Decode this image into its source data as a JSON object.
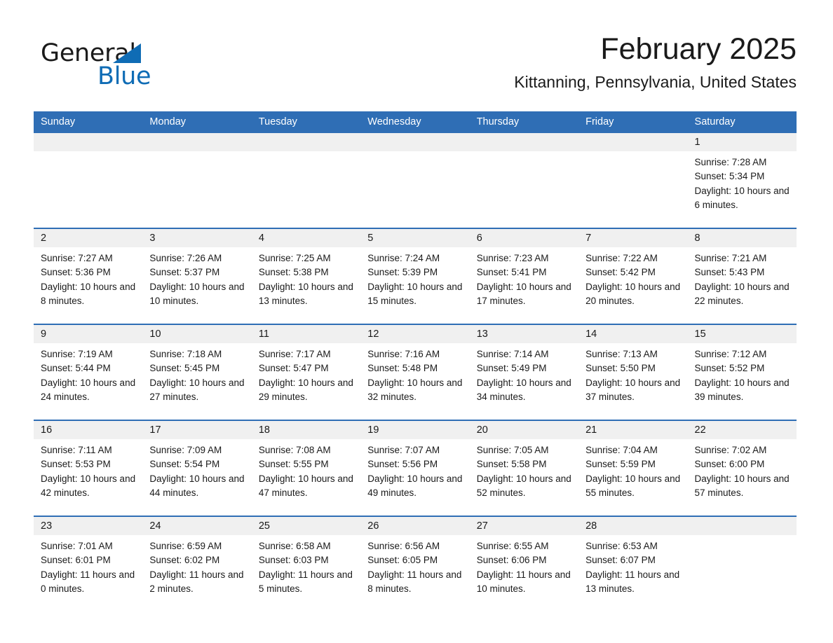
{
  "brand": {
    "word_one": "General",
    "word_two": "Blue",
    "triangle_color": "#0f6cb5",
    "accent_color": "#2f6eb5"
  },
  "header": {
    "title": "February 2025",
    "subtitle": "Kittanning, Pennsylvania, United States"
  },
  "calendar": {
    "weekday_headers": [
      "Sunday",
      "Monday",
      "Tuesday",
      "Wednesday",
      "Thursday",
      "Friday",
      "Saturday"
    ],
    "labels": {
      "sunrise": "Sunrise:",
      "sunset": "Sunset:",
      "daylight": "Daylight:"
    },
    "weeks": [
      [
        {
          "day": "",
          "sunrise": "",
          "sunset": "",
          "daylight": ""
        },
        {
          "day": "",
          "sunrise": "",
          "sunset": "",
          "daylight": ""
        },
        {
          "day": "",
          "sunrise": "",
          "sunset": "",
          "daylight": ""
        },
        {
          "day": "",
          "sunrise": "",
          "sunset": "",
          "daylight": ""
        },
        {
          "day": "",
          "sunrise": "",
          "sunset": "",
          "daylight": ""
        },
        {
          "day": "",
          "sunrise": "",
          "sunset": "",
          "daylight": ""
        },
        {
          "day": "1",
          "sunrise": "Sunrise: 7:28 AM",
          "sunset": "Sunset: 5:34 PM",
          "daylight": "Daylight: 10 hours and 6 minutes."
        }
      ],
      [
        {
          "day": "2",
          "sunrise": "Sunrise: 7:27 AM",
          "sunset": "Sunset: 5:36 PM",
          "daylight": "Daylight: 10 hours and 8 minutes."
        },
        {
          "day": "3",
          "sunrise": "Sunrise: 7:26 AM",
          "sunset": "Sunset: 5:37 PM",
          "daylight": "Daylight: 10 hours and 10 minutes."
        },
        {
          "day": "4",
          "sunrise": "Sunrise: 7:25 AM",
          "sunset": "Sunset: 5:38 PM",
          "daylight": "Daylight: 10 hours and 13 minutes."
        },
        {
          "day": "5",
          "sunrise": "Sunrise: 7:24 AM",
          "sunset": "Sunset: 5:39 PM",
          "daylight": "Daylight: 10 hours and 15 minutes."
        },
        {
          "day": "6",
          "sunrise": "Sunrise: 7:23 AM",
          "sunset": "Sunset: 5:41 PM",
          "daylight": "Daylight: 10 hours and 17 minutes."
        },
        {
          "day": "7",
          "sunrise": "Sunrise: 7:22 AM",
          "sunset": "Sunset: 5:42 PM",
          "daylight": "Daylight: 10 hours and 20 minutes."
        },
        {
          "day": "8",
          "sunrise": "Sunrise: 7:21 AM",
          "sunset": "Sunset: 5:43 PM",
          "daylight": "Daylight: 10 hours and 22 minutes."
        }
      ],
      [
        {
          "day": "9",
          "sunrise": "Sunrise: 7:19 AM",
          "sunset": "Sunset: 5:44 PM",
          "daylight": "Daylight: 10 hours and 24 minutes."
        },
        {
          "day": "10",
          "sunrise": "Sunrise: 7:18 AM",
          "sunset": "Sunset: 5:45 PM",
          "daylight": "Daylight: 10 hours and 27 minutes."
        },
        {
          "day": "11",
          "sunrise": "Sunrise: 7:17 AM",
          "sunset": "Sunset: 5:47 PM",
          "daylight": "Daylight: 10 hours and 29 minutes."
        },
        {
          "day": "12",
          "sunrise": "Sunrise: 7:16 AM",
          "sunset": "Sunset: 5:48 PM",
          "daylight": "Daylight: 10 hours and 32 minutes."
        },
        {
          "day": "13",
          "sunrise": "Sunrise: 7:14 AM",
          "sunset": "Sunset: 5:49 PM",
          "daylight": "Daylight: 10 hours and 34 minutes."
        },
        {
          "day": "14",
          "sunrise": "Sunrise: 7:13 AM",
          "sunset": "Sunset: 5:50 PM",
          "daylight": "Daylight: 10 hours and 37 minutes."
        },
        {
          "day": "15",
          "sunrise": "Sunrise: 7:12 AM",
          "sunset": "Sunset: 5:52 PM",
          "daylight": "Daylight: 10 hours and 39 minutes."
        }
      ],
      [
        {
          "day": "16",
          "sunrise": "Sunrise: 7:11 AM",
          "sunset": "Sunset: 5:53 PM",
          "daylight": "Daylight: 10 hours and 42 minutes."
        },
        {
          "day": "17",
          "sunrise": "Sunrise: 7:09 AM",
          "sunset": "Sunset: 5:54 PM",
          "daylight": "Daylight: 10 hours and 44 minutes."
        },
        {
          "day": "18",
          "sunrise": "Sunrise: 7:08 AM",
          "sunset": "Sunset: 5:55 PM",
          "daylight": "Daylight: 10 hours and 47 minutes."
        },
        {
          "day": "19",
          "sunrise": "Sunrise: 7:07 AM",
          "sunset": "Sunset: 5:56 PM",
          "daylight": "Daylight: 10 hours and 49 minutes."
        },
        {
          "day": "20",
          "sunrise": "Sunrise: 7:05 AM",
          "sunset": "Sunset: 5:58 PM",
          "daylight": "Daylight: 10 hours and 52 minutes."
        },
        {
          "day": "21",
          "sunrise": "Sunrise: 7:04 AM",
          "sunset": "Sunset: 5:59 PM",
          "daylight": "Daylight: 10 hours and 55 minutes."
        },
        {
          "day": "22",
          "sunrise": "Sunrise: 7:02 AM",
          "sunset": "Sunset: 6:00 PM",
          "daylight": "Daylight: 10 hours and 57 minutes."
        }
      ],
      [
        {
          "day": "23",
          "sunrise": "Sunrise: 7:01 AM",
          "sunset": "Sunset: 6:01 PM",
          "daylight": "Daylight: 11 hours and 0 minutes."
        },
        {
          "day": "24",
          "sunrise": "Sunrise: 6:59 AM",
          "sunset": "Sunset: 6:02 PM",
          "daylight": "Daylight: 11 hours and 2 minutes."
        },
        {
          "day": "25",
          "sunrise": "Sunrise: 6:58 AM",
          "sunset": "Sunset: 6:03 PM",
          "daylight": "Daylight: 11 hours and 5 minutes."
        },
        {
          "day": "26",
          "sunrise": "Sunrise: 6:56 AM",
          "sunset": "Sunset: 6:05 PM",
          "daylight": "Daylight: 11 hours and 8 minutes."
        },
        {
          "day": "27",
          "sunrise": "Sunrise: 6:55 AM",
          "sunset": "Sunset: 6:06 PM",
          "daylight": "Daylight: 11 hours and 10 minutes."
        },
        {
          "day": "28",
          "sunrise": "Sunrise: 6:53 AM",
          "sunset": "Sunset: 6:07 PM",
          "daylight": "Daylight: 11 hours and 13 minutes."
        },
        {
          "day": "",
          "sunrise": "",
          "sunset": "",
          "daylight": ""
        }
      ]
    ]
  }
}
